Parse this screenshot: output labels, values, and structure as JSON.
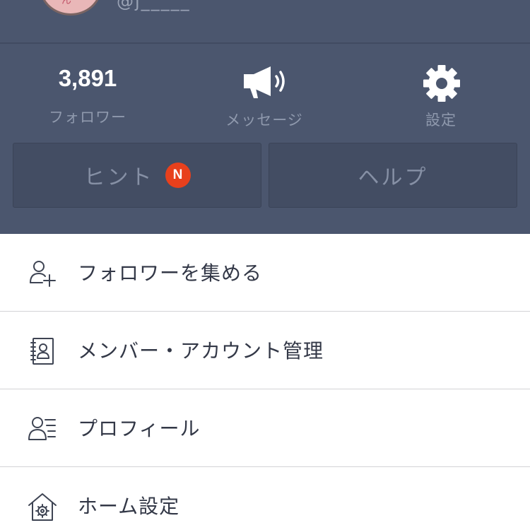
{
  "account": {
    "subtitle": "@j_____"
  },
  "stats": {
    "followers": {
      "value": "3,891",
      "label": "フォロワー"
    },
    "message": {
      "label": "メッセージ"
    },
    "settings": {
      "label": "設定"
    }
  },
  "panel_buttons": {
    "hint": {
      "label": "ヒント",
      "badge": "N"
    },
    "help": {
      "label": "ヘルプ"
    }
  },
  "menu": {
    "items": [
      {
        "label": "フォロワーを集める",
        "icon": "add-user-icon"
      },
      {
        "label": "メンバー・アカウント管理",
        "icon": "contact-book-icon"
      },
      {
        "label": "プロフィール",
        "icon": "profile-card-icon"
      },
      {
        "label": "ホーム設定",
        "icon": "home-settings-icon"
      }
    ]
  },
  "colors": {
    "panel_bg": "#4b566e",
    "panel_button_bg": "#434d63",
    "badge": "#e8401c",
    "menu_text": "#333847",
    "divider": "#d3d3d6"
  }
}
